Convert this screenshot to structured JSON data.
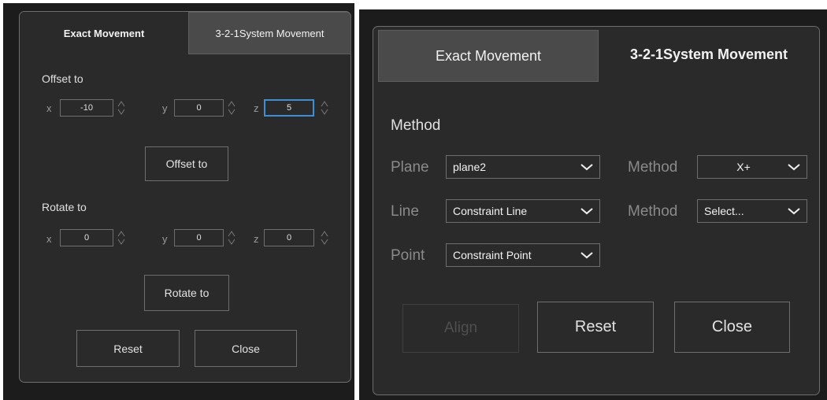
{
  "left_panel": {
    "tabs": [
      "Exact Movement",
      "3-2-1System  Movement"
    ],
    "offset": {
      "title": "Offset to",
      "x_label": "x",
      "x_value": "-10",
      "y_label": "y",
      "y_value": "0",
      "z_label": "z",
      "z_value": "5",
      "button": "Offset to"
    },
    "rotate": {
      "title": "Rotate to",
      "x_label": "x",
      "x_value": "0",
      "y_label": "y",
      "y_value": "0",
      "z_label": "z",
      "z_value": "0",
      "button": "Rotate to"
    },
    "reset_button": "Reset",
    "close_button": "Close"
  },
  "right_panel": {
    "tabs": [
      "Exact Movement",
      "3-2-1System  Movement"
    ],
    "method_title": "Method",
    "plane_label": "Plane",
    "plane_value": "plane2",
    "plane_method_label": "Method",
    "plane_method_value": "X+",
    "line_label": "Line",
    "line_value": "Constraint Line",
    "line_method_label": "Method",
    "line_method_value": "Select...",
    "point_label": "Point",
    "point_value": "Constraint Point",
    "align_button": "Align",
    "reset_button": "Reset",
    "close_button": "Close"
  },
  "colors": {
    "background": "#2a2a2a",
    "border": "#6e6e6e",
    "focus_accent": "#3a8fd6",
    "text": "#e0e0e0"
  }
}
